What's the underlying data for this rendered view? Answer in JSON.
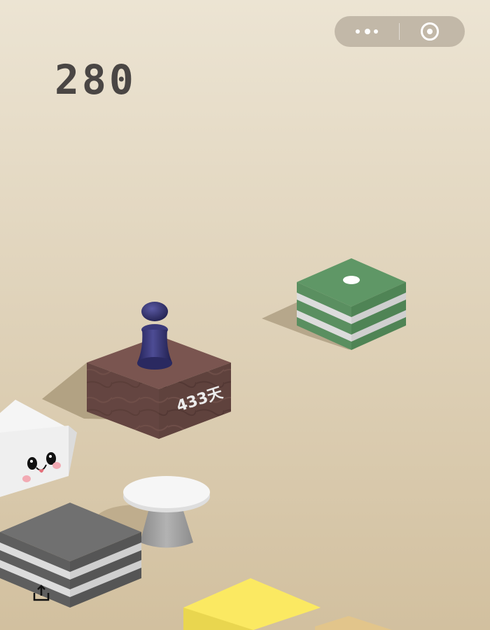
{
  "capsule": {
    "more_icon": "more-dots-icon",
    "close_icon": "target-close-icon"
  },
  "score": "280",
  "platforms": {
    "brown_box_label": "433天"
  },
  "colors": {
    "bg_top": "#ebe3d1",
    "bg_bottom": "#d3c1a1",
    "score": "#4a4644",
    "player": "#3b3a7a",
    "green": "#5b9262",
    "brown": "#6f4e48",
    "gray": "#666666",
    "yellow": "#f5e35f"
  },
  "share": {
    "icon": "share-icon"
  }
}
